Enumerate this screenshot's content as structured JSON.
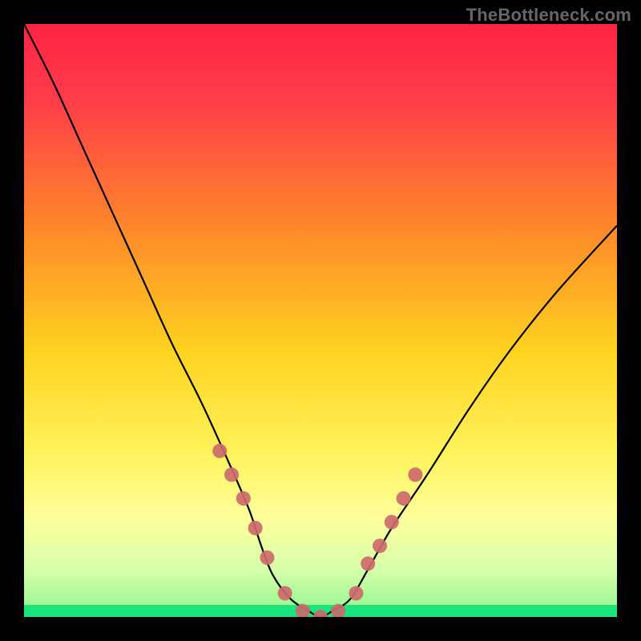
{
  "watermark": "TheBottleneck.com",
  "colors": {
    "black": "#000000",
    "curve": "#000000",
    "marker": "#cc6a6b",
    "green": "#18e57c",
    "gradient_top": "#ff2a4a",
    "gradient_mid": "#ffd22a",
    "gradient_low": "#ffff99",
    "gradient_bottom": "#8ef58e"
  },
  "chart_data": {
    "type": "line",
    "title": "",
    "xlabel": "",
    "ylabel": "",
    "xlim": [
      0,
      100
    ],
    "ylim": [
      0,
      100
    ],
    "grid": false,
    "legend": false,
    "series": [
      {
        "name": "bottleneck-curve",
        "x": [
          0,
          5,
          10,
          15,
          20,
          25,
          30,
          35,
          38,
          40,
          42,
          45,
          48,
          50,
          52,
          55,
          58,
          62,
          68,
          75,
          82,
          90,
          100
        ],
        "y": [
          100,
          90,
          79,
          68,
          57,
          46,
          36,
          25,
          18,
          12,
          7,
          3,
          1,
          0,
          1,
          3,
          8,
          15,
          24,
          35,
          45,
          55,
          66
        ]
      }
    ],
    "markers": {
      "name": "sample-points",
      "x": [
        33,
        35,
        37,
        39,
        41,
        44,
        47,
        50,
        53,
        56,
        58,
        60,
        62,
        64,
        66
      ],
      "y": [
        28,
        24,
        20,
        15,
        10,
        4,
        1,
        0,
        1,
        4,
        9,
        12,
        16,
        20,
        24
      ]
    },
    "bottom_band": {
      "from_y": 0,
      "to_y": 2
    }
  }
}
